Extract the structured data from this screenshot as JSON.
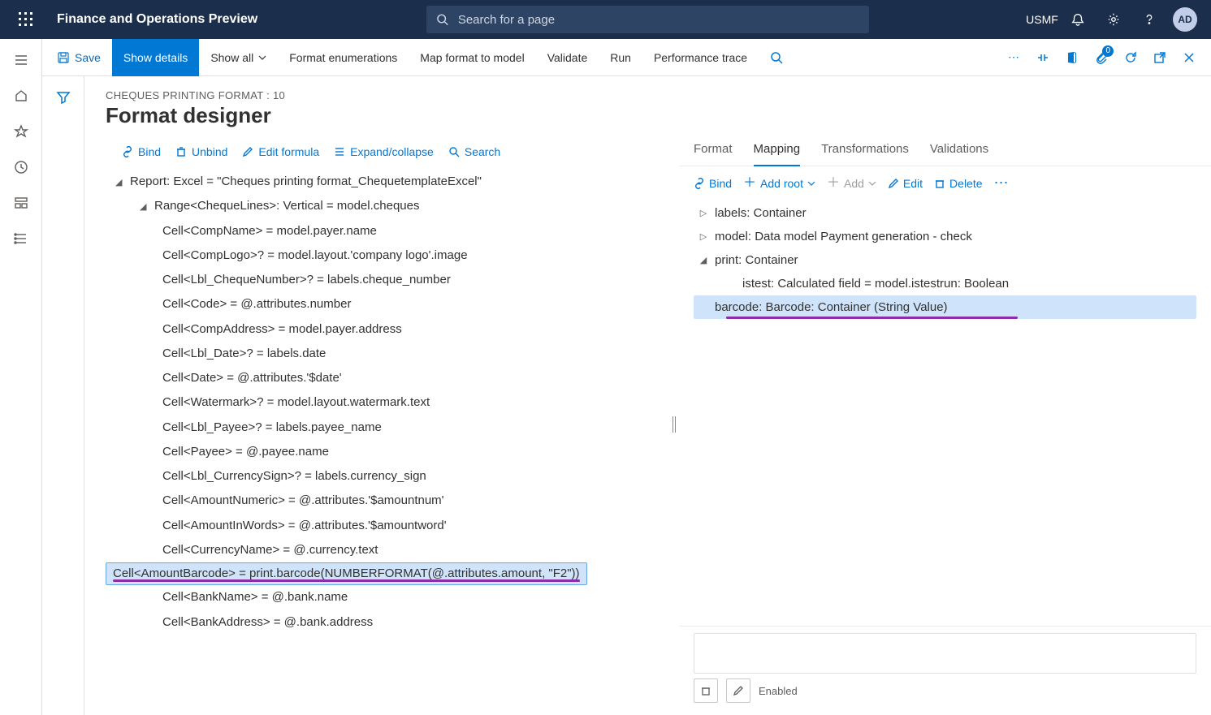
{
  "topbar": {
    "product": "Finance and Operations Preview",
    "search_placeholder": "Search for a page",
    "company": "USMF",
    "avatar": "AD"
  },
  "actionbar": {
    "save": "Save",
    "show_details": "Show details",
    "show_all": "Show all",
    "format_enum": "Format enumerations",
    "map_format": "Map format to model",
    "validate": "Validate",
    "run": "Run",
    "perf_trace": "Performance trace",
    "badge_count": "0"
  },
  "page": {
    "crumb": "CHEQUES PRINTING FORMAT : 10",
    "title": "Format designer"
  },
  "left_toolbar": {
    "bind": "Bind",
    "unbind": "Unbind",
    "edit_formula": "Edit formula",
    "expand": "Expand/collapse",
    "search": "Search"
  },
  "left_tree": {
    "root": "Report: Excel = \"Cheques printing format_ChequetemplateExcel\"",
    "range": "Range<ChequeLines>: Vertical = model.cheques",
    "cells": [
      "Cell<CompName> = model.payer.name",
      "Cell<CompLogo>? = model.layout.'company logo'.image",
      "Cell<Lbl_ChequeNumber>? = labels.cheque_number",
      "Cell<Code> = @.attributes.number",
      "Cell<CompAddress> = model.payer.address",
      "Cell<Lbl_Date>? = labels.date",
      "Cell<Date> = @.attributes.'$date'",
      "Cell<Watermark>? = model.layout.watermark.text",
      "Cell<Lbl_Payee>? = labels.payee_name",
      "Cell<Payee> = @.payee.name",
      "Cell<Lbl_CurrencySign>? = labels.currency_sign",
      "Cell<AmountNumeric> = @.attributes.'$amountnum'",
      "Cell<AmountInWords> = @.attributes.'$amountword'",
      "Cell<CurrencyName> = @.currency.text",
      "Cell<AmountBarcode> = print.barcode(NUMBERFORMAT(@.attributes.amount, \"F2\"))",
      "Cell<BankName> = @.bank.name",
      "Cell<BankAddress> = @.bank.address"
    ],
    "selected_index": 14
  },
  "right_tabs": {
    "format": "Format",
    "mapping": "Mapping",
    "transformations": "Transformations",
    "validations": "Validations"
  },
  "right_toolbar": {
    "bind": "Bind",
    "add_root": "Add root",
    "add": "Add",
    "edit": "Edit",
    "delete": "Delete"
  },
  "right_tree": {
    "labels": "labels: Container",
    "model": "model: Data model Payment generation - check",
    "print": "print: Container",
    "istest": "istest: Calculated field = model.istestrun: Boolean",
    "barcode": "barcode: Barcode: Container (String Value)"
  },
  "right_bottom": {
    "enabled": "Enabled"
  }
}
